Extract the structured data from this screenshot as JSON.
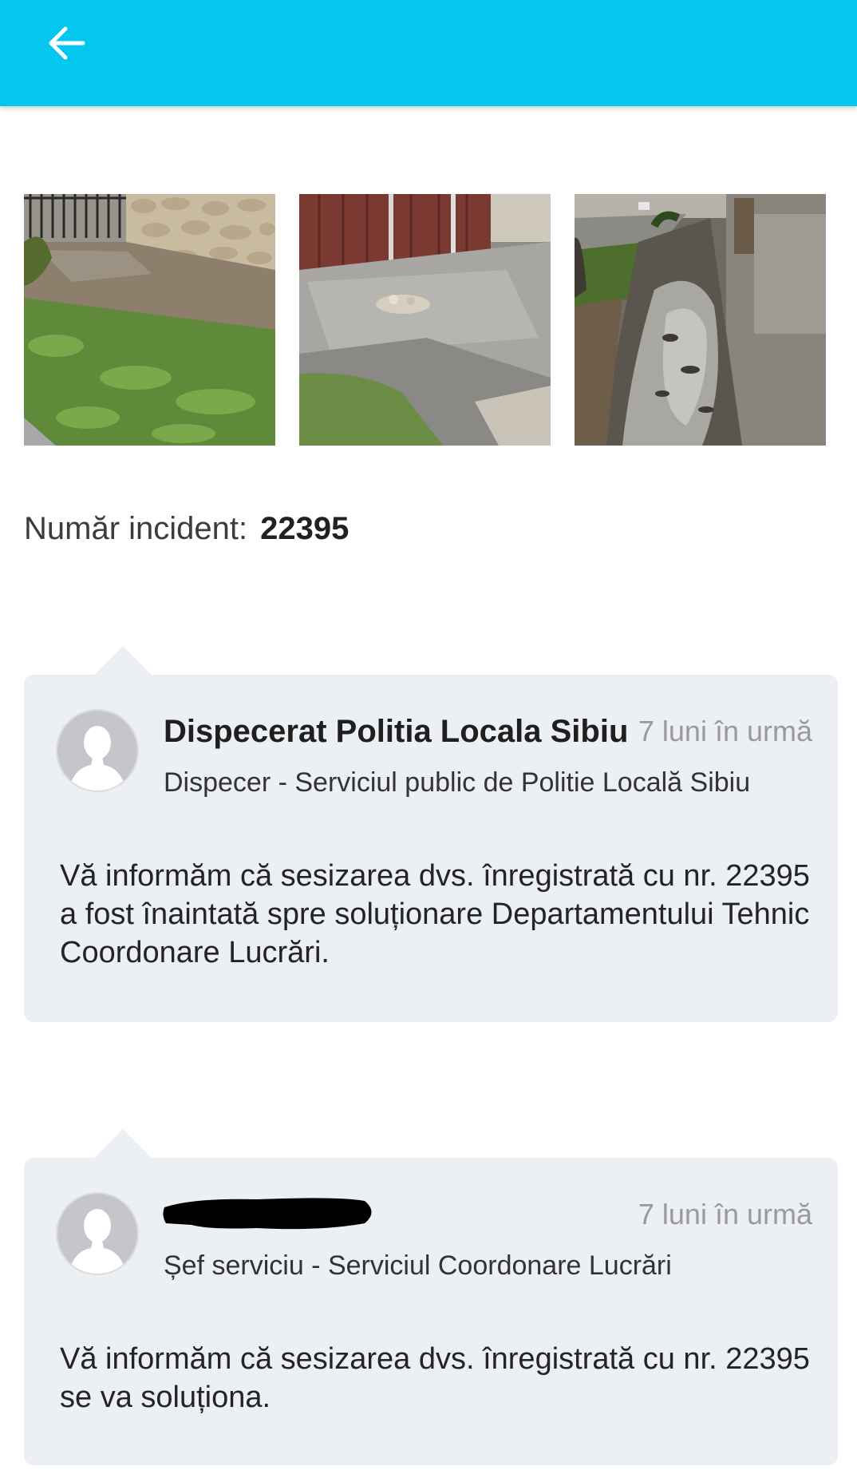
{
  "appbar": {
    "background": "#04c6ef",
    "back_icon": "arrow-left-icon"
  },
  "photos": [
    {
      "name": "incident-photo-1",
      "description_icon": "photo"
    },
    {
      "name": "incident-photo-2",
      "description_icon": "photo"
    },
    {
      "name": "incident-photo-3",
      "description_icon": "photo"
    }
  ],
  "incident": {
    "label": "Număr incident:",
    "number": "22395"
  },
  "comments": [
    {
      "author": "Dispecerat Politia Locala Sibiu",
      "time": "7 luni în urmă",
      "role": "Dispecer - Serviciul public de Politie Locală Sibiu",
      "message": "Vă informăm că sesizarea dvs. înregistrată cu nr. 22395 a fost înaintată spre soluționare Departamentului Tehnic Coordonare Lucrări.",
      "avatar_icon": "user-placeholder-icon"
    },
    {
      "author": "",
      "author_redacted": true,
      "time": "7 luni în urmă",
      "role": "Șef serviciu - Serviciul Coordonare Lucrări",
      "message": "Vă informăm că sesizarea dvs. înregistrată cu nr. 22395 se va soluționa.",
      "avatar_icon": "user-placeholder-icon"
    }
  ],
  "colors": {
    "accent": "#04c6ef",
    "card_background": "#eceff3",
    "timestamp": "#9a9a9a"
  }
}
